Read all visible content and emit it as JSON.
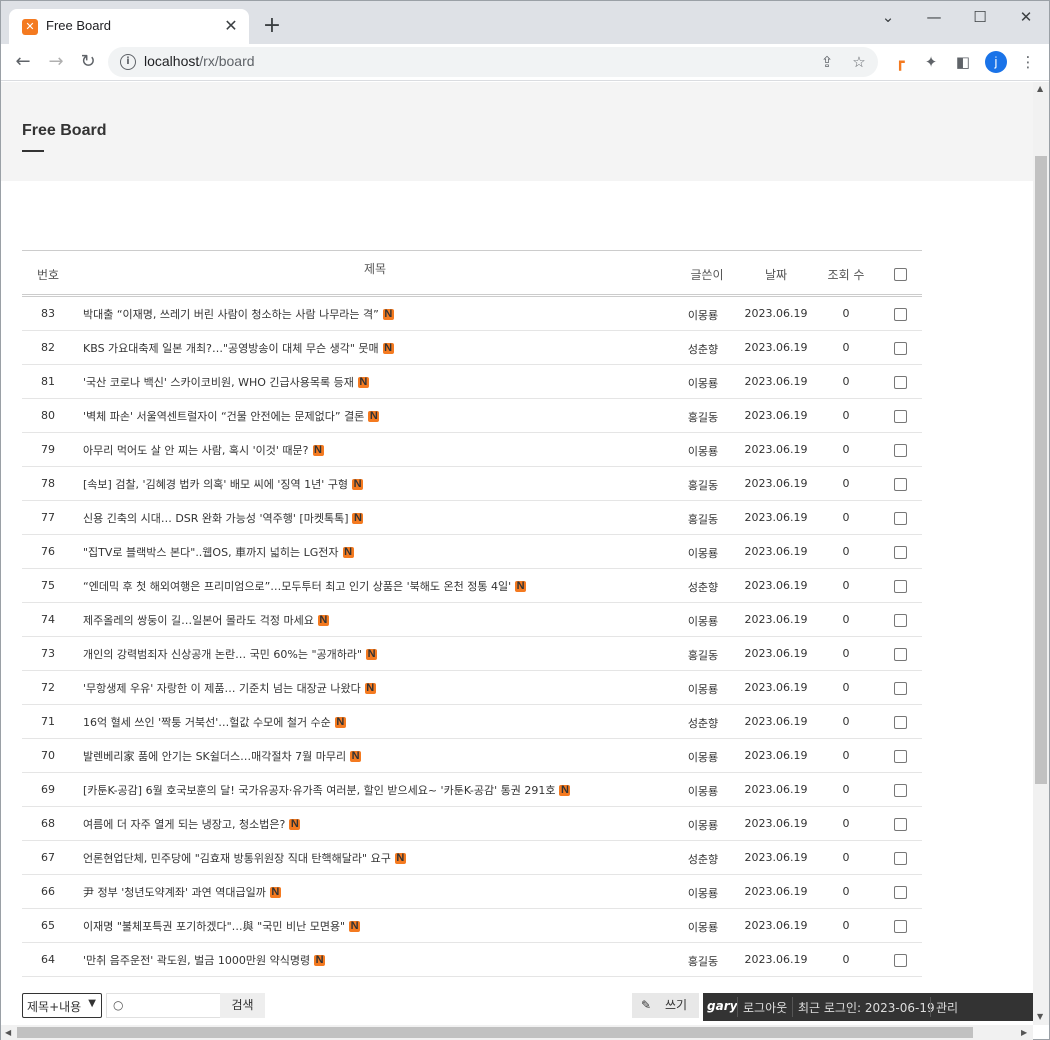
{
  "browser": {
    "tab_title": "Free Board",
    "favicon_glyph": "⌘",
    "url_host": "localhost",
    "url_path": "/rx/board",
    "avatar_letter": "j"
  },
  "page": {
    "title": "Free Board"
  },
  "table": {
    "headers": {
      "no": "번호",
      "title": "제목",
      "author": "글쓴이",
      "date": "날짜",
      "views": "조회 수"
    },
    "new_badge": "N",
    "rows": [
      {
        "no": "83",
        "title": "박대출 “이재명, 쓰레기 버린 사람이 청소하는 사람 나무라는 격”",
        "author": "이몽룡",
        "date": "2023.06.19",
        "views": "0"
      },
      {
        "no": "82",
        "title": "KBS 가요대축제 일본 개최?…\"공영방송이 대체 무슨 생각\" 뭇매",
        "author": "성춘향",
        "date": "2023.06.19",
        "views": "0"
      },
      {
        "no": "81",
        "title": "'국산 코로나 백신' 스카이코비원, WHO 긴급사용목록 등재",
        "author": "이몽룡",
        "date": "2023.06.19",
        "views": "0"
      },
      {
        "no": "80",
        "title": "'벽체 파손' 서울역센트럴자이 “건물 안전에는 문제없다” 결론",
        "author": "홍길동",
        "date": "2023.06.19",
        "views": "0"
      },
      {
        "no": "79",
        "title": "아무리 먹어도 살 안 찌는 사람, 혹시 '이것' 때문?",
        "author": "이몽룡",
        "date": "2023.06.19",
        "views": "0"
      },
      {
        "no": "78",
        "title": "[속보] 검찰, '김혜경 법카 의혹' 배모 씨에 '징역 1년' 구형",
        "author": "홍길동",
        "date": "2023.06.19",
        "views": "0"
      },
      {
        "no": "77",
        "title": "신용 긴축의 시대… DSR 완화 가능성 '역주행' [마켓톡톡]",
        "author": "홍길동",
        "date": "2023.06.19",
        "views": "0"
      },
      {
        "no": "76",
        "title": "\"집TV로 블랙박스 본다\"..웹OS, 車까지 넓히는 LG전자",
        "author": "이몽룡",
        "date": "2023.06.19",
        "views": "0"
      },
      {
        "no": "75",
        "title": "“엔데믹 후 첫 해외여행은 프리미엄으로”…모두투터 최고 인기 상품은 '북해도 온천 정통 4일'",
        "author": "성춘향",
        "date": "2023.06.19",
        "views": "0"
      },
      {
        "no": "74",
        "title": "제주올레의 쌍둥이 길…일본어 몰라도 걱정 마세요",
        "author": "이몽룡",
        "date": "2023.06.19",
        "views": "0"
      },
      {
        "no": "73",
        "title": "개인의 강력범죄자 신상공개 논란… 국민 60%는 \"공개하라\"",
        "author": "홍길동",
        "date": "2023.06.19",
        "views": "0"
      },
      {
        "no": "72",
        "title": "'무항생제 우유' 자랑한 이 제품… 기준치 넘는 대장균 나왔다",
        "author": "이몽룡",
        "date": "2023.06.19",
        "views": "0"
      },
      {
        "no": "71",
        "title": "16억 혈세 쓰인 '짝퉁 거북선'…헐값 수모에 철거 수순",
        "author": "성춘향",
        "date": "2023.06.19",
        "views": "0"
      },
      {
        "no": "70",
        "title": "발렌베리家 품에 안기는 SK쉴더스…매각절차 7월 마무리",
        "author": "이몽룡",
        "date": "2023.06.19",
        "views": "0"
      },
      {
        "no": "69",
        "title": "[카툰K-공감] 6월 호국보훈의 달! 국가유공자·유가족 여러분, 할인 받으세요~ '카툰K-공감' 통권 291호",
        "author": "이몽룡",
        "date": "2023.06.19",
        "views": "0"
      },
      {
        "no": "68",
        "title": "여름에 더 자주 열게 되는 냉장고, 청소법은?",
        "author": "이몽룡",
        "date": "2023.06.19",
        "views": "0"
      },
      {
        "no": "67",
        "title": "언론현업단체, 민주당에 \"김효재 방통위원장 직대 탄핵해달라\" 요구",
        "author": "성춘향",
        "date": "2023.06.19",
        "views": "0"
      },
      {
        "no": "66",
        "title": "尹 정부 '청년도약계좌' 과연 역대급일까",
        "author": "이몽룡",
        "date": "2023.06.19",
        "views": "0"
      },
      {
        "no": "65",
        "title": "이재명 \"불체포특권 포기하겠다\"…與 \"국민 비난 모면용\"",
        "author": "이몽룡",
        "date": "2023.06.19",
        "views": "0"
      },
      {
        "no": "64",
        "title": "'만취 음주운전' 곽도원, 벌금 1000만원 약식명령",
        "author": "홍길동",
        "date": "2023.06.19",
        "views": "0"
      }
    ]
  },
  "search": {
    "type_selected": "제목+내용",
    "button_label": "검색"
  },
  "write_label": "쓰기",
  "userbar": {
    "username": "gary",
    "logout": "로그아웃",
    "last_login": "최근 로그인: 2023-06-19",
    "admin": "관리"
  }
}
